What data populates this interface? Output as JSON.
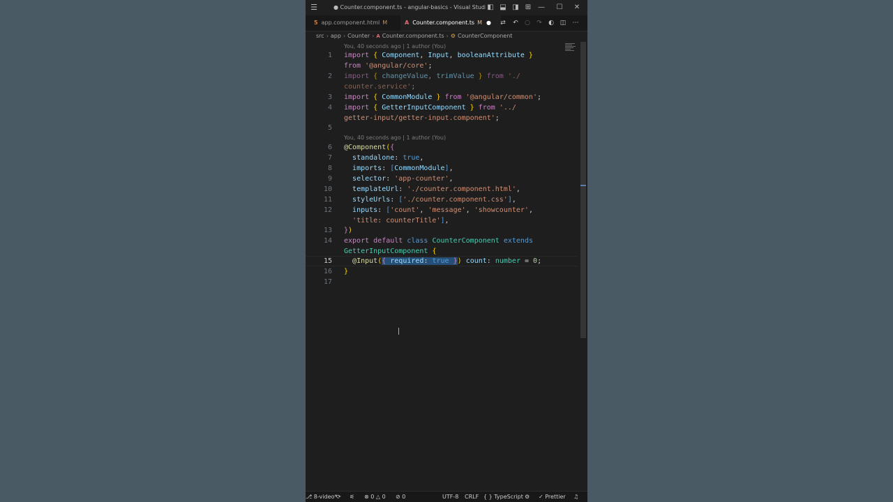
{
  "window": {
    "title": "● Counter.component.ts - angular-basics - Visual Studi...",
    "controls": {
      "minimize": "—",
      "maximize": "☐",
      "close": "✕"
    }
  },
  "tabs": [
    {
      "label": "app.component.html",
      "modified": "M",
      "icon": "html-file-icon",
      "active": false
    },
    {
      "label": "Counter.component.ts",
      "modified": "M",
      "icon": "angular-file-icon",
      "active": true,
      "dirty": "●"
    }
  ],
  "breadcrumb": [
    "src",
    "app",
    "Counter",
    "Counter.component.ts",
    "CounterComponent"
  ],
  "codelens": [
    "You, 40 seconds ago | 1 author (You)",
    "You, 40 seconds ago | 1 author (You)"
  ],
  "line_numbers": [
    "1",
    "2",
    "3",
    "4",
    "5",
    "6",
    "7",
    "8",
    "9",
    "10",
    "11",
    "12",
    "13",
    "14",
    "15",
    "16",
    "17"
  ],
  "code": {
    "l1a": "import",
    "l1b": " { ",
    "l1c": "Component",
    "l1d": ", ",
    "l1e": "Input",
    "l1f": ", ",
    "l1g": "booleanAttribute",
    "l1h": " }",
    "l1w1": "from",
    "l1w2": " ",
    "l1w3": "'@angular/core'",
    "l1w4": ";",
    "l2a": "import",
    "l2b": " { ",
    "l2c": "changeValue",
    "l2d": ", ",
    "l2e": "trimValue",
    "l2f": " } ",
    "l2g": "from",
    "l2h": " ",
    "l2i": "'./",
    "l2w": "counter.service'",
    "l2w2": ";",
    "l3a": "import",
    "l3b": " { ",
    "l3c": "CommonModule",
    "l3d": " } ",
    "l3e": "from",
    "l3f": " ",
    "l3g": "'@angular/common'",
    "l3h": ";",
    "l4a": "import",
    "l4b": " { ",
    "l4c": "GetterInputComponent",
    "l4d": " } ",
    "l4e": "from",
    "l4f": " ",
    "l4g": "'../",
    "l4w": "getter-input/getter-input.component'",
    "l4w2": ";",
    "l6a": "@",
    "l6b": "Component",
    "l6c": "(",
    "l6d": "{",
    "l7a": "standalone",
    "l7b": ": ",
    "l7c": "true",
    "l7d": ",",
    "l8a": "imports",
    "l8b": ": ",
    "l8c": "[",
    "l8d": "CommonModule",
    "l8e": "]",
    "l8f": ",",
    "l9a": "selector",
    "l9b": ": ",
    "l9c": "'app-counter'",
    "l9d": ",",
    "l10a": "templateUrl",
    "l10b": ": ",
    "l10c": "'./counter.component.html'",
    "l10d": ",",
    "l11a": "styleUrls",
    "l11b": ": ",
    "l11c": "[",
    "l11d": "'./counter.component.css'",
    "l11e": "]",
    "l11f": ",",
    "l12a": "inputs",
    "l12b": ": ",
    "l12c": "[",
    "l12d": "'count'",
    "l12e": ", ",
    "l12f": "'message'",
    "l12g": ", ",
    "l12h": "'showcounter'",
    "l12i": ",",
    "l12w1": "'title: counterTitle'",
    "l12w2": "]",
    "l12w3": ",",
    "l13a": "}",
    "l13b": ")",
    "l14a": "export",
    "l14b": " ",
    "l14c": "default",
    "l14d": " ",
    "l14e": "class",
    "l14f": " ",
    "l14g": "CounterComponent",
    "l14h": " ",
    "l14i": "extends",
    "l14w1": "GetterInputComponent",
    "l14w2": " ",
    "l14w3": "{",
    "l15a": "@",
    "l15b": "Input",
    "l15c": "(",
    "l15d": "{ ",
    "l15e": "required",
    "l15f": ": ",
    "l15g": "true",
    "l15h": " }",
    "l15i": ")",
    "l15j": " ",
    "l15k": "count",
    "l15l": ": ",
    "l15m": "number",
    "l15n": " = ",
    "l15o": "0",
    "l15p": ";",
    "l16a": "}"
  },
  "status": {
    "branch": "8-video*",
    "errors": "0",
    "warnings": "0",
    "ports": "0",
    "encoding": "UTF-8",
    "eol": "CRLF",
    "language": "TypeScript",
    "formatter": "Prettier",
    "language_prefix": "{ }"
  }
}
